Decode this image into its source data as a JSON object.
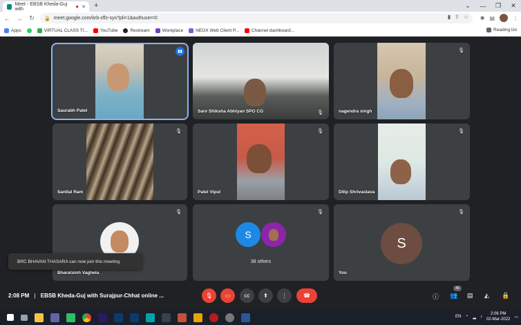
{
  "browser": {
    "tab_title": "Meet - EBSB Kheda-Guj with",
    "url": "meet.google.com/krb-zffz-sys?pli=1&authuser=0",
    "reading_list": "Reading list",
    "bookmarks": [
      {
        "label": "Apps",
        "color": "#4285f4"
      },
      {
        "label": "",
        "color": "#25d366"
      },
      {
        "label": "VIRTUAL CLASS TI...",
        "color": "#34a853"
      },
      {
        "label": "YouTube",
        "color": "#ff0000"
      },
      {
        "label": "Restream",
        "color": "#222222"
      },
      {
        "label": "Workplace",
        "color": "#6f42c1"
      },
      {
        "label": "NEOX Web Client P...",
        "color": "#7b5cd6"
      },
      {
        "label": "Channel dashboard...",
        "color": "#ff0000"
      }
    ]
  },
  "participants": [
    {
      "name": "Saurabh Patel",
      "speaking": true
    },
    {
      "name": "Sarv Shiksha Abhiyan SPO CG",
      "speaking": false
    },
    {
      "name": "nagendra singh",
      "speaking": false
    },
    {
      "name": "Santlal Ram",
      "speaking": false
    },
    {
      "name": "Patel Vipul",
      "speaking": false
    },
    {
      "name": "Dilip Shrivastava",
      "speaking": false
    },
    {
      "name": "Bharatsinh Vaghela",
      "speaking": false
    },
    {
      "name": "38 others",
      "initial": "S",
      "speaking": false
    },
    {
      "name": "You",
      "initial": "S",
      "speaking": false
    }
  ],
  "toast": "BRC BHAVAN THASARA can now join this meeting",
  "meeting": {
    "time": "2:08 PM",
    "separator": "|",
    "title": "EBSB Kheda-Guj with Surajpur-Chhat online ...",
    "people_count": "46"
  },
  "taskbar": {
    "lang": "EN",
    "time": "2:08 PM",
    "date": "02-Mar-2022"
  },
  "colors": {
    "background": "#202124",
    "tile": "#3c4043",
    "active_outline": "#8ab4f8",
    "danger": "#ea4335"
  }
}
